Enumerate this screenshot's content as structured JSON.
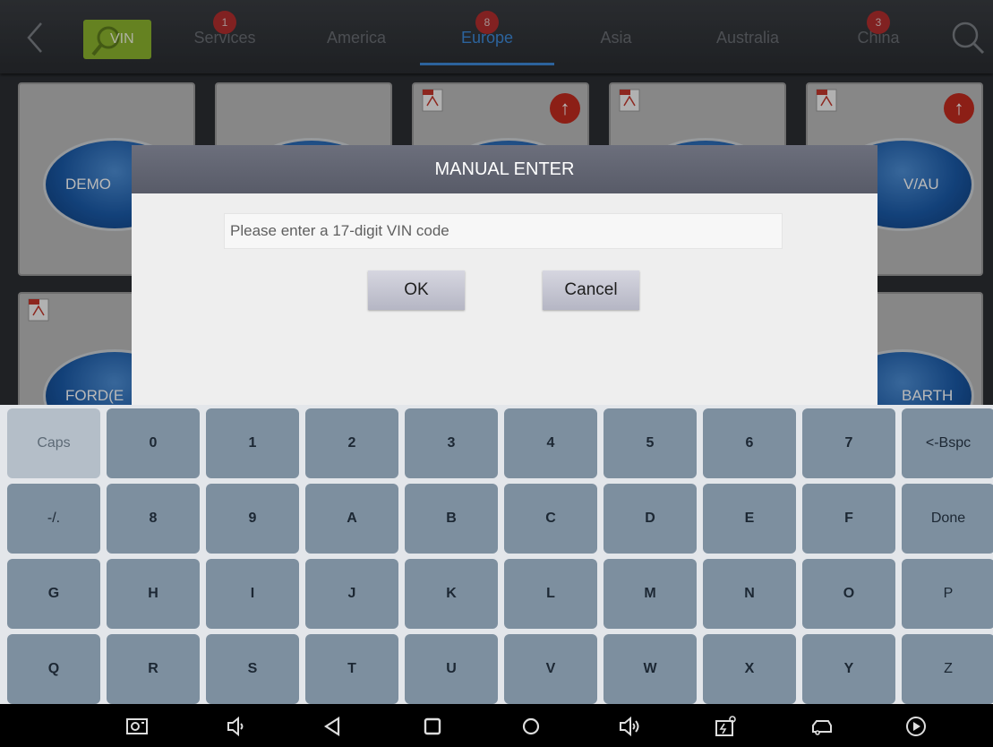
{
  "topbar": {
    "vin_label": "VIN",
    "tabs": [
      {
        "label": "Services",
        "badge": "1"
      },
      {
        "label": "America",
        "badge": ""
      },
      {
        "label": "Europe",
        "badge": "8"
      },
      {
        "label": "Asia",
        "badge": ""
      },
      {
        "label": "Australia",
        "badge": ""
      },
      {
        "label": "China",
        "badge": "3"
      }
    ]
  },
  "cards": [
    {
      "label": "DEMO"
    },
    {
      "label": ""
    },
    {
      "label": ""
    },
    {
      "label": ""
    },
    {
      "label": "V/AU"
    },
    {
      "label": "FORD(E"
    },
    {
      "label": "BARTH"
    }
  ],
  "dialog": {
    "title": "MANUAL ENTER",
    "input_placeholder": "Please enter a 17-digit VIN code",
    "input_value": "",
    "ok_label": "OK",
    "cancel_label": "Cancel"
  },
  "keyboard": {
    "rows": [
      [
        "Caps",
        "0",
        "1",
        "2",
        "3",
        "4",
        "5",
        "6",
        "7",
        "<-Bspc"
      ],
      [
        "-/.",
        "8",
        "9",
        "A",
        "B",
        "C",
        "D",
        "E",
        "F",
        "Done"
      ],
      [
        "G",
        "H",
        "I",
        "J",
        "K",
        "L",
        "M",
        "N",
        "O",
        "P"
      ],
      [
        "Q",
        "R",
        "S",
        "T",
        "U",
        "V",
        "W",
        "X",
        "Y",
        "Z"
      ]
    ]
  },
  "navbar": {
    "icons": [
      "screenshot-icon",
      "volume-down-icon",
      "back-icon",
      "home-icon",
      "recents-icon",
      "volume-up-icon",
      "vci-icon",
      "car-icon",
      "play-icon"
    ]
  },
  "colors": {
    "accent": "#3d8ad8",
    "vin_button": "#8cb52f",
    "badge": "#b32e2e",
    "key": "#7d8f9f",
    "dialog_header": "#5f6270"
  }
}
